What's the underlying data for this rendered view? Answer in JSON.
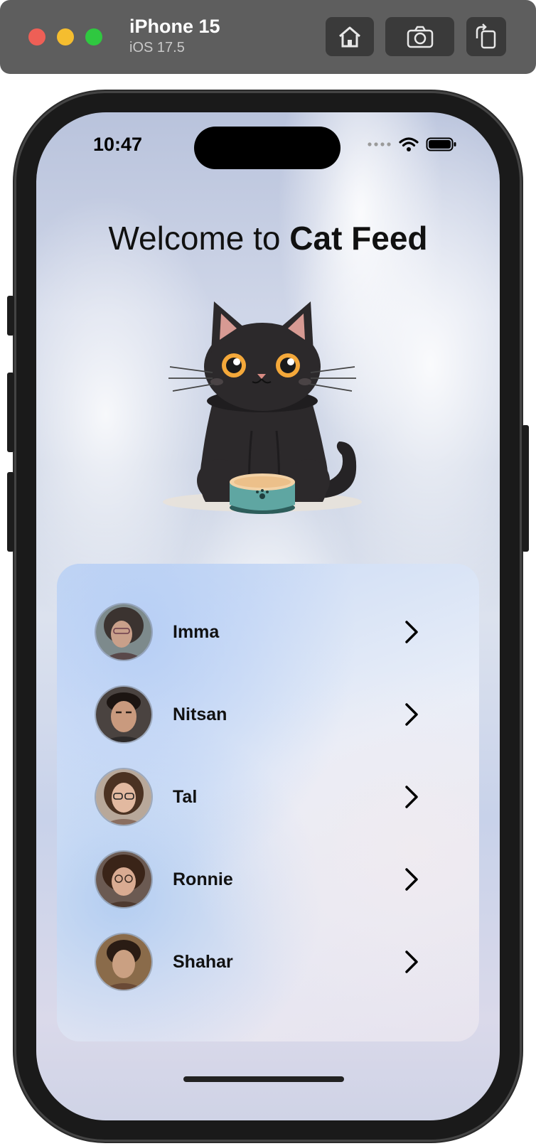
{
  "simulator": {
    "device_name": "iPhone 15",
    "os_version": "iOS 17.5",
    "buttons": [
      {
        "name": "home-button",
        "icon": "home-icon"
      },
      {
        "name": "screenshot-button",
        "icon": "camera-icon"
      },
      {
        "name": "rotate-button",
        "icon": "rotate-icon"
      }
    ]
  },
  "status_bar": {
    "time": "10:47"
  },
  "header": {
    "title_prefix": "Welcome to ",
    "title_app": "Cat Feed"
  },
  "users": [
    {
      "name": "Imma"
    },
    {
      "name": "Nitsan"
    },
    {
      "name": "Tal"
    },
    {
      "name": "Ronnie"
    },
    {
      "name": "Shahar"
    }
  ],
  "colors": {
    "toolbar": "#5e5e5e",
    "close": "#ee5f56",
    "minimize": "#f5bd2f",
    "zoom": "#2fc840",
    "bowl": "#5fa6a2"
  }
}
